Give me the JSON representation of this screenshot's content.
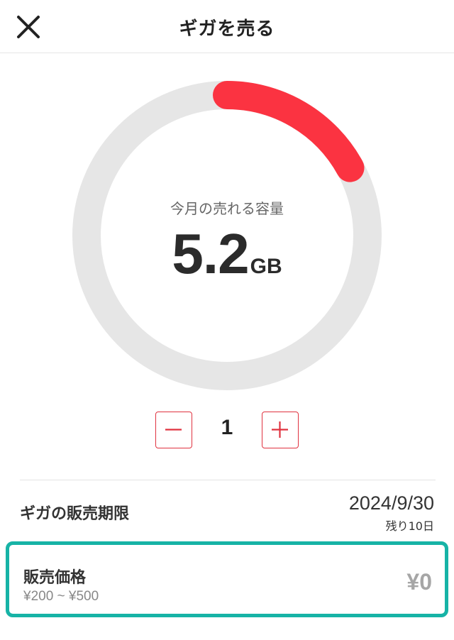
{
  "header": {
    "title": "ギガを売る",
    "close_icon": "close-icon"
  },
  "gauge": {
    "label": "今月の売れる容量",
    "value": "5.2",
    "unit": "GB",
    "fill_fraction": 0.17,
    "colors": {
      "track": "#e6e6e6",
      "fill": "#fb3341"
    }
  },
  "stepper": {
    "value": "1",
    "minus_icon": "minus-icon",
    "plus_icon": "plus-icon",
    "accent_color": "#e0323f"
  },
  "deadline": {
    "label": "ギガの販売期限",
    "date": "2024/9/30",
    "remaining": "残り10日"
  },
  "price": {
    "label": "販売価格",
    "range": "¥200 ~ ¥500",
    "value": "¥0",
    "highlight_color": "#17b3a6"
  }
}
